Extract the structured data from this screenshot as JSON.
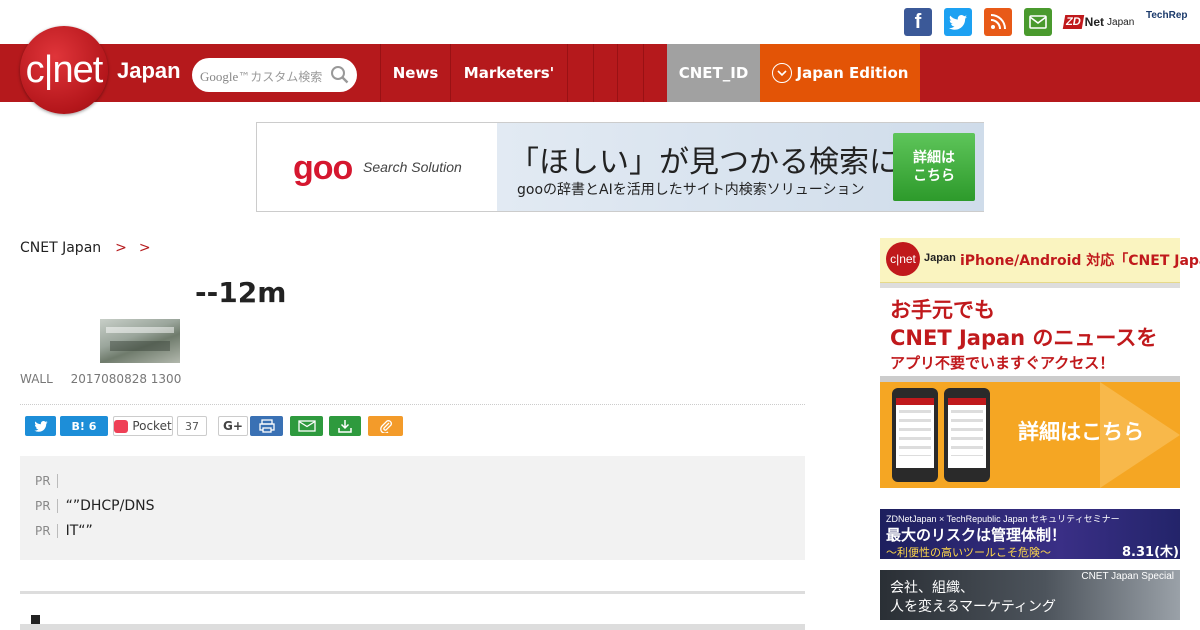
{
  "topbar": {
    "facebook_glyph": "f",
    "zdnet_mark": "ZD",
    "zdnet_net": "Net",
    "zdnet_japan": "Japan",
    "techrepublic": "TechRep",
    "icons": [
      "facebook-icon",
      "twitter-icon",
      "rss-icon",
      "mail-icon"
    ]
  },
  "brand": {
    "logo": "c|net",
    "japan": "Japan",
    "color": "#b5191c"
  },
  "search": {
    "google": "Google",
    "tm": "™",
    "placeholder": "カスタム検索"
  },
  "nav": {
    "items": [
      "News",
      "Marketers'",
      "",
      "",
      "",
      ""
    ],
    "cnet_id": "CNET_ID",
    "edition": "Japan Edition",
    "edition_color": "#e35406",
    "cnet_id_color": "#a1a1a1"
  },
  "ad": {
    "brand": "goo",
    "brand_sub": "Search Solution",
    "headline": "「ほしい」が見つかる検索に。",
    "sub": "gooの辞書とAIを活用したサイト内検索ソリューション",
    "button": "詳細は\nこちら"
  },
  "breadcrumb": {
    "home": "CNET Japan",
    "sep": ">",
    "section": "",
    "current": ""
  },
  "article": {
    "title": "--12m",
    "source": "WALL",
    "date": "2017080828 1300"
  },
  "share": {
    "hatena": "B!",
    "hatena_count": "6",
    "pocket": "Pocket",
    "pocket_count": "37",
    "gplus": "G+"
  },
  "pr": {
    "tag": "PR",
    "items": [
      "",
      "“”DHCP/DNS",
      "IT“”"
    ]
  },
  "sidebar": {
    "app_logo": "c|net",
    "app_japan": "Japan",
    "app_bar": "iPhone/Android 対応「CNET Japan」",
    "app_h1": "お手元でも",
    "app_h2": "CNET Japan のニュースを",
    "app_h3": "アプリ不要でいますぐアクセス！",
    "app_cta": "詳細はこちら",
    "seminar_a": "ZDNetJapan × TechRepublic Japan セキュリティセミナー",
    "seminar_b": "最大のリスクは管理体制！",
    "seminar_c": "〜利便性の高いツールこそ危険〜",
    "seminar_date": "8.31(木)",
    "special_a": "会社、組織、",
    "special_b": "人を変えるマーケティング",
    "special_tag": "CNET Japan Special"
  }
}
